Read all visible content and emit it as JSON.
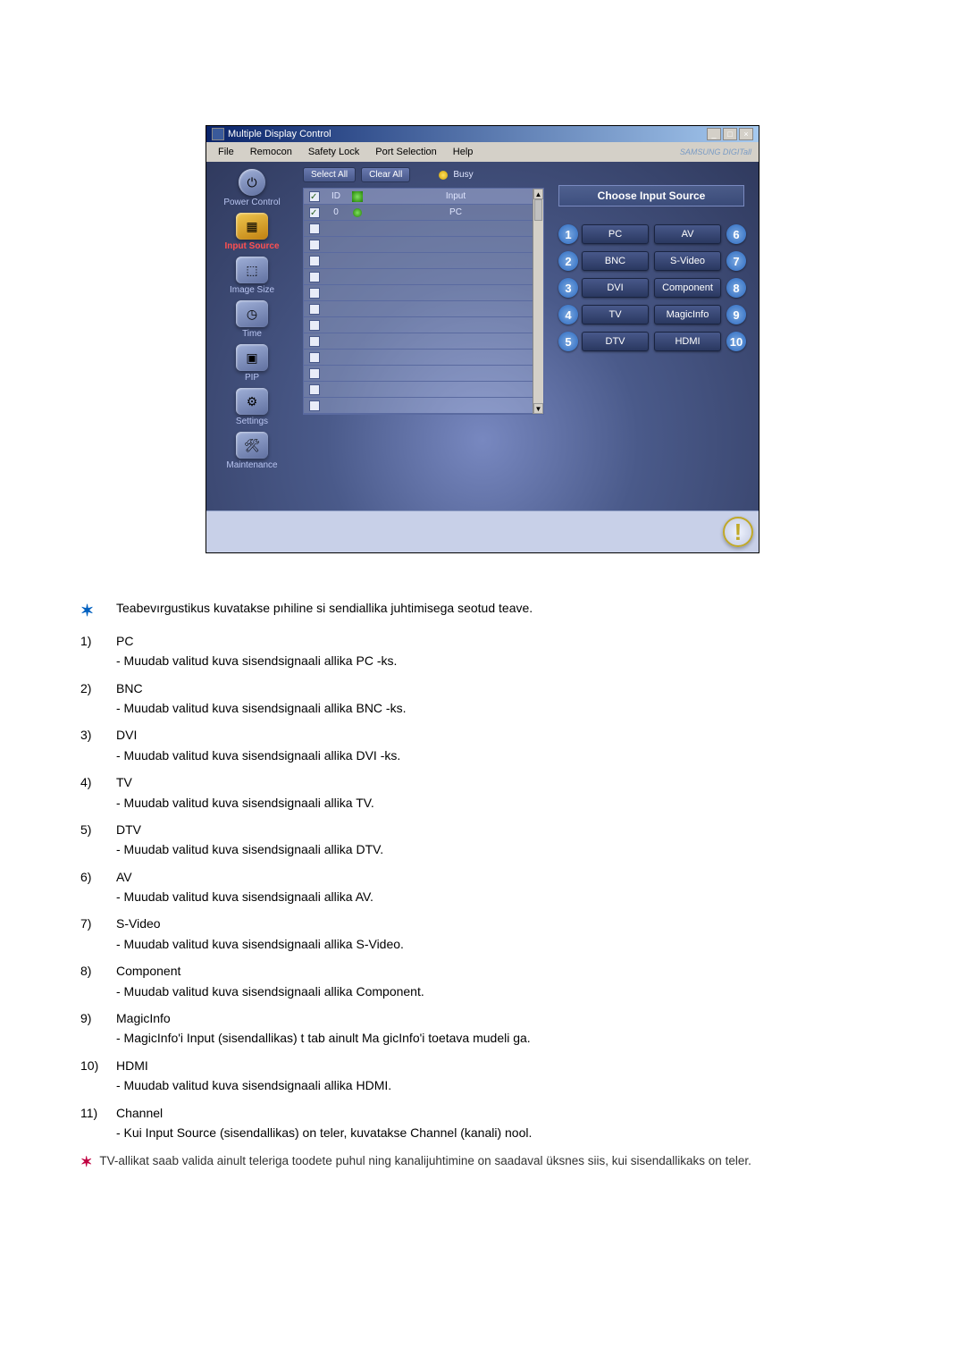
{
  "window": {
    "title": "Multiple Display Control",
    "menu": [
      "File",
      "Remocon",
      "Safety Lock",
      "Port Selection",
      "Help"
    ],
    "brand": "SAMSUNG DIGITall"
  },
  "sidebar": {
    "items": [
      {
        "label": "Power Control"
      },
      {
        "label": "Input Source"
      },
      {
        "label": "Image Size"
      },
      {
        "label": "Time"
      },
      {
        "label": "PIP"
      },
      {
        "label": "Settings"
      },
      {
        "label": "Maintenance"
      }
    ]
  },
  "toolbar": {
    "select_all": "Select All",
    "clear_all": "Clear All",
    "busy": "Busy"
  },
  "grid": {
    "headers": {
      "id": "ID",
      "input": "Input"
    },
    "rows": [
      {
        "id": "0",
        "input": "PC",
        "checked": true
      }
    ],
    "empty_rows": 11
  },
  "right": {
    "header": "Choose Input Source",
    "sources_left": [
      {
        "n": "1",
        "label": "PC"
      },
      {
        "n": "2",
        "label": "BNC"
      },
      {
        "n": "3",
        "label": "DVI"
      },
      {
        "n": "4",
        "label": "TV"
      },
      {
        "n": "5",
        "label": "DTV"
      }
    ],
    "sources_right": [
      {
        "n": "6",
        "label": "AV"
      },
      {
        "n": "7",
        "label": "S-Video"
      },
      {
        "n": "8",
        "label": "Component"
      },
      {
        "n": "9",
        "label": "MagicInfo"
      },
      {
        "n": "10",
        "label": "HDMI"
      }
    ]
  },
  "doc": {
    "star_text": "Teabevırgustikus kuvatakse pıhiline si sendiallika juhtimisega seotud teave.",
    "items": [
      {
        "n": "1)",
        "title": "PC",
        "desc": " - Muudab valitud kuva sisendsignaali allika PC -ks."
      },
      {
        "n": "2)",
        "title": "BNC",
        "desc": " - Muudab valitud kuva sisendsignaali allika BNC -ks."
      },
      {
        "n": "3)",
        "title": "DVI",
        "desc": " - Muudab valitud kuva sisendsignaali allika DVI -ks."
      },
      {
        "n": "4)",
        "title": "TV",
        "desc": " - Muudab valitud kuva sisendsignaali allika TV."
      },
      {
        "n": "5)",
        "title": "DTV",
        "desc": " - Muudab valitud kuva sisendsignaali allika DTV."
      },
      {
        "n": "6)",
        "title": "AV",
        "desc": " - Muudab valitud kuva sisendsignaali allika AV."
      },
      {
        "n": "7)",
        "title": "S-Video",
        "desc": " - Muudab valitud kuva sisendsignaali allika S-Video."
      },
      {
        "n": "8)",
        "title": "Component",
        "desc": " - Muudab valitud kuva sisendsignaali allika Component."
      },
      {
        "n": "9)",
        "title": "MagicInfo",
        "desc": " - MagicInfo'i Input (sisendallikas) t   tab ainult Ma   gicInfo'i toetava mudeli ga."
      },
      {
        "n": "10)",
        "title": "HDMI",
        "desc": " - Muudab valitud kuva sisendsignaali allika HDMI."
      },
      {
        "n": "11)",
        "title": "Channel",
        "desc": " - Kui Input Source (sisendallikas) on teler, kuvatakse Channel (kanali) nool."
      }
    ],
    "tv_note": "TV-allikat saab valida ainult teleriga toodete puhul ning kanalijuhtimine on saadaval üksnes siis, kui sisendallikaks on teler."
  }
}
